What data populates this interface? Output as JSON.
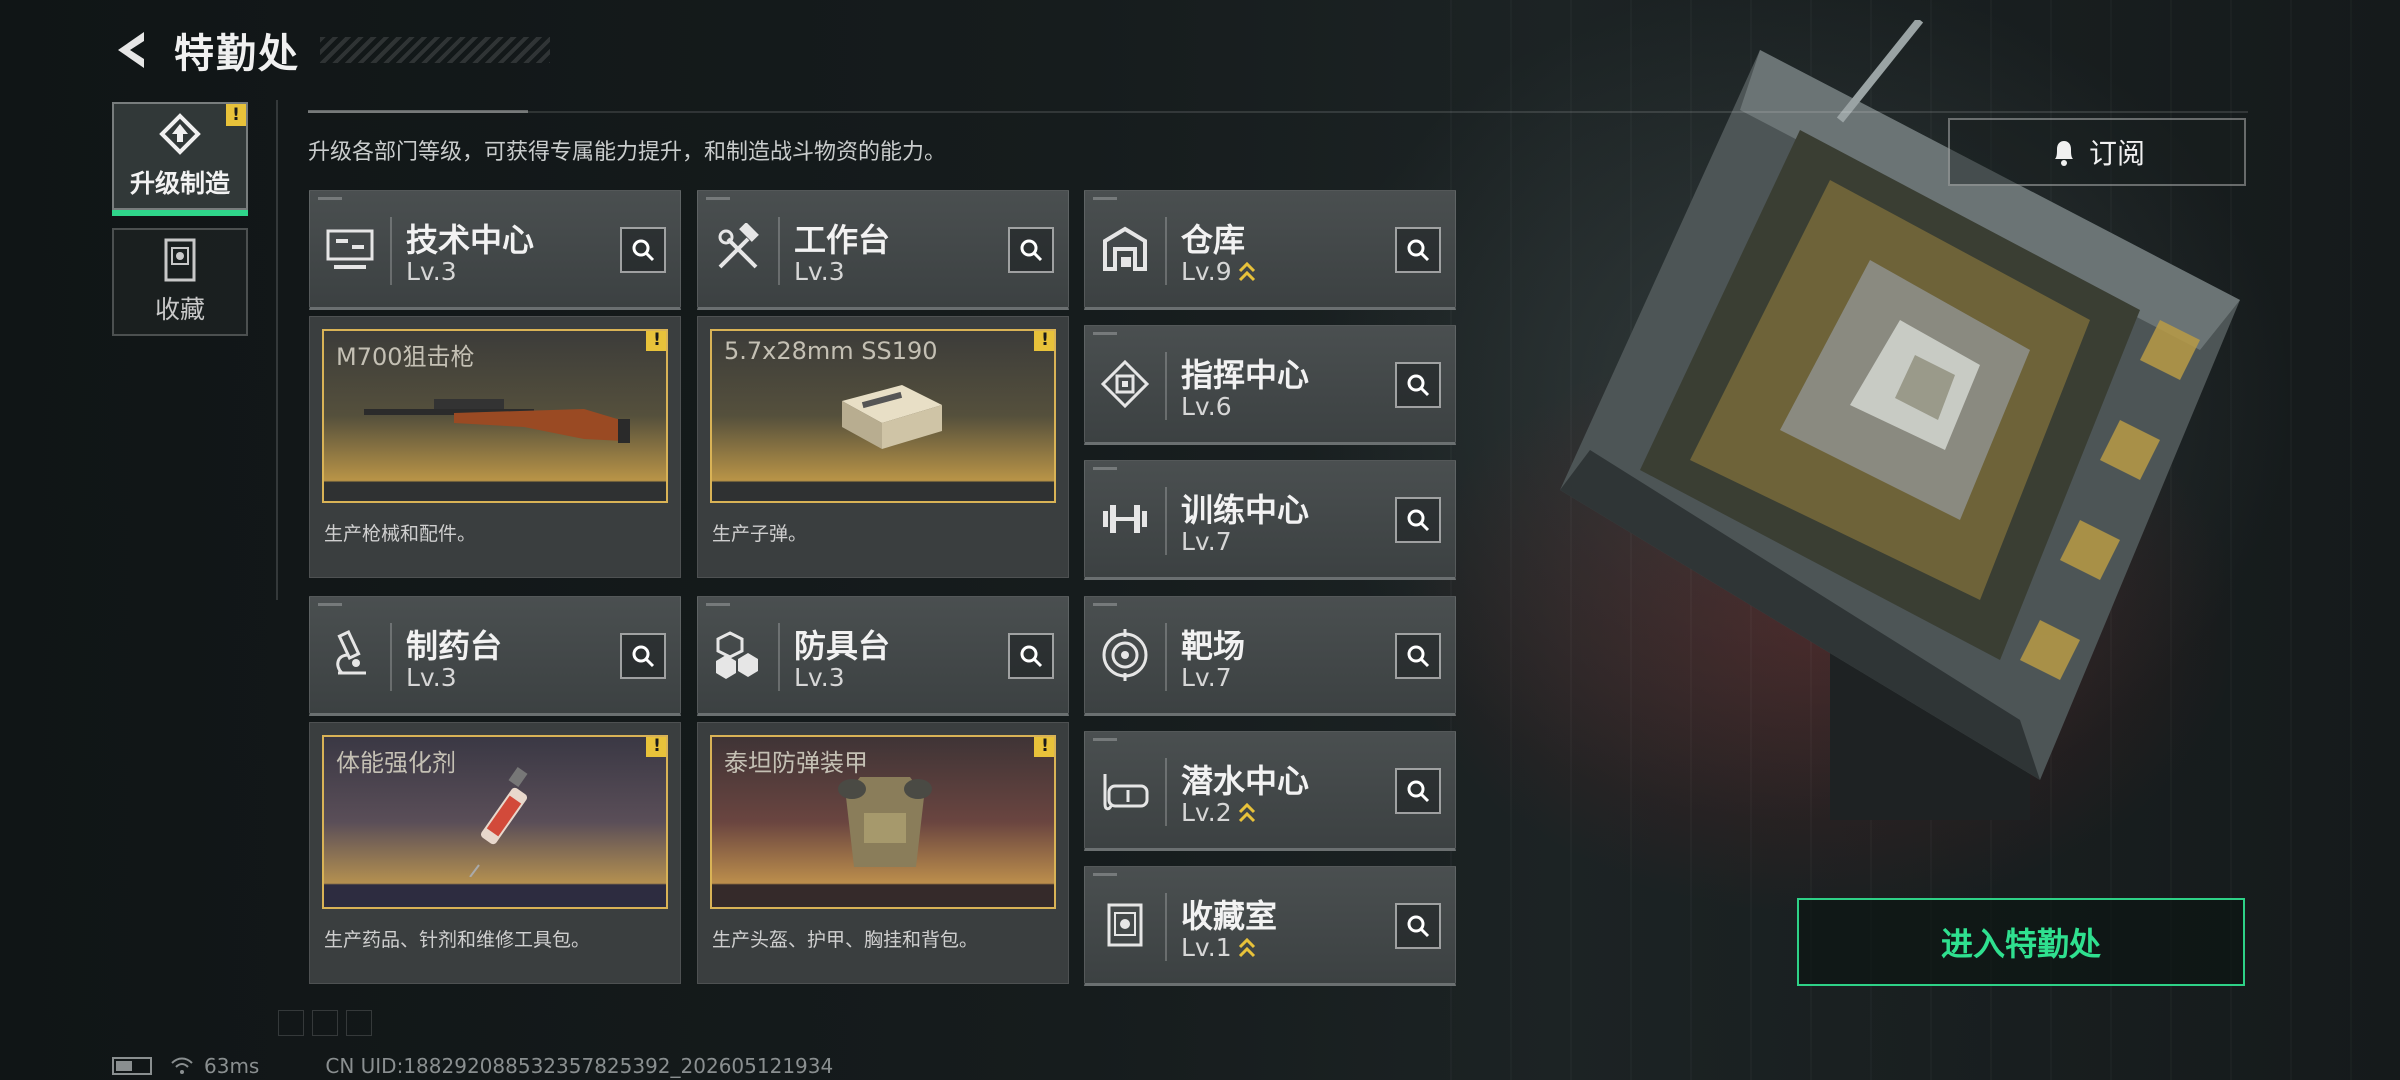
{
  "header": {
    "title": "特勤处"
  },
  "description": "升级各部门等级，可获得专属能力提升，和制造战斗物资的能力。",
  "tabs": [
    {
      "label": "升级制造",
      "badge": "!"
    },
    {
      "label": "收藏"
    }
  ],
  "production_cards": [
    {
      "name": "技术中心",
      "level": "Lv.3",
      "item": "M700狙击枪",
      "badge": "!",
      "desc": "生产枪械和配件。"
    },
    {
      "name": "工作台",
      "level": "Lv.3",
      "item": "5.7x28mm SS190",
      "badge": "!",
      "desc": "生产子弹。"
    },
    {
      "name": "制药台",
      "level": "Lv.3",
      "item": "体能强化剂",
      "badge": "!",
      "desc": "生产药品、针剂和维修工具包。"
    },
    {
      "name": "防具台",
      "level": "Lv.3",
      "item": "泰坦防弹装甲",
      "badge": "!",
      "desc": "生产头盔、护甲、胸挂和背包。"
    }
  ],
  "facilities": [
    {
      "name": "仓库",
      "level": "Lv.9",
      "upgradable": true
    },
    {
      "name": "指挥中心",
      "level": "Lv.6",
      "upgradable": false
    },
    {
      "name": "训练中心",
      "level": "Lv.7",
      "upgradable": false
    },
    {
      "name": "靶场",
      "level": "Lv.7",
      "upgradable": false
    },
    {
      "name": "潜水中心",
      "level": "Lv.2",
      "upgradable": true
    },
    {
      "name": "收藏室",
      "level": "Lv.1",
      "upgradable": true
    }
  ],
  "buttons": {
    "subscribe": "订阅",
    "enter": "进入特勤处"
  },
  "footer": {
    "ping": "63ms",
    "uid": "CN UID:18829208853235782539​2_202605121934"
  },
  "colors": {
    "accent_green": "#2ed187",
    "badge_yellow": "#e8c23a",
    "item_border": "#d9b356"
  }
}
